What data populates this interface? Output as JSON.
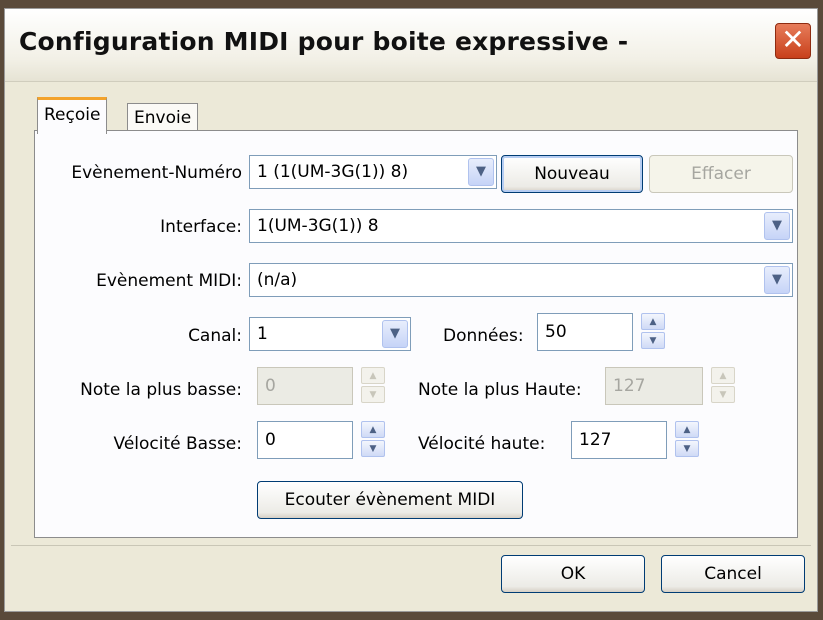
{
  "window": {
    "title": "Configuration MIDI pour boite expressive -",
    "close_symbol": "✕"
  },
  "tabs": [
    {
      "label": "Reçoie",
      "active": true
    },
    {
      "label": "Envoie",
      "active": false
    }
  ],
  "form": {
    "event_number": {
      "label": "Evènement-Numéro",
      "value": "1 (1(UM-3G(1)) 8)"
    },
    "new_button": "Nouveau",
    "delete_button": "Effacer",
    "interface": {
      "label": "Interface:",
      "value": "1(UM-3G(1)) 8"
    },
    "midi_event": {
      "label": "Evènement MIDI:",
      "value": "(n/a)"
    },
    "channel": {
      "label": "Canal:",
      "value": "1"
    },
    "data": {
      "label": "Données:",
      "value": "50"
    },
    "lowest_note": {
      "label": "Note la plus basse:",
      "value": "0"
    },
    "highest_note": {
      "label": "Note la plus Haute:",
      "value": "127"
    },
    "velocity_low": {
      "label": "Vélocité Basse:",
      "value": "0"
    },
    "velocity_high": {
      "label": "Vélocité haute:",
      "value": "127"
    },
    "listen_button": "Ecouter évènement MIDI"
  },
  "footer": {
    "ok": "OK",
    "cancel": "Cancel"
  },
  "icons": {
    "dropdown": "▼",
    "spin_up": "▲",
    "spin_down": "▼"
  },
  "colors": {
    "accent": "#f3a32c",
    "close": "#c8401b",
    "input_border": "#7f9db9"
  }
}
